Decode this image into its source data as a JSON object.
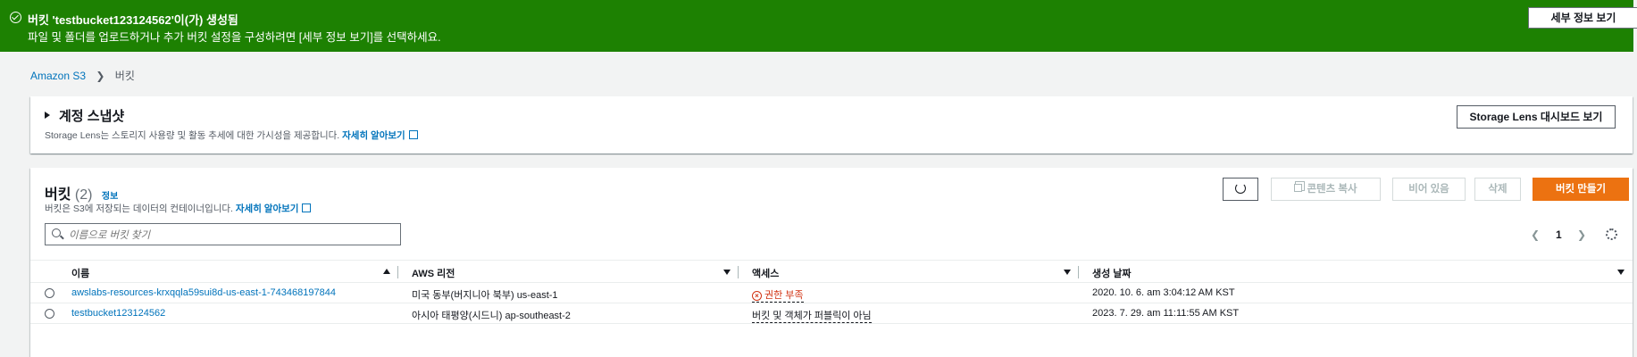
{
  "flash": {
    "title": "버킷 'testbucket123124562'이(가) 생성됨",
    "message": "파일 및 폴더를 업로드하거나 추가 버킷 설정을 구성하려면 [세부 정보 보기]를 선택하세요.",
    "details_button": "세부 정보 보기",
    "color": "#1d8102"
  },
  "breadcrumb": {
    "root": "Amazon S3",
    "current": "버킷"
  },
  "lens": {
    "heading": "계정 스냅샷",
    "description": "Storage Lens는 스토리지 사용량 및 활동 추세에 대한 가시성을 제공합니다.",
    "learn_more": "자세히 알아보기",
    "dashboard_button": "Storage Lens 대시보드 보기"
  },
  "buckets": {
    "title": "버킷",
    "count": "(2)",
    "info": "정보",
    "description": "버킷은 S3에 저장되는 데이터의 컨테이너입니다.",
    "learn_more": "자세히 알아보기",
    "toolbar": {
      "copy": "콘텐츠 복사",
      "empty": "비어 있음",
      "delete": "삭제",
      "create": "버킷 만들기",
      "create_color": "#ec7211"
    },
    "search_placeholder": "이름으로 버킷 찾기",
    "page": "1",
    "columns": {
      "name": "이름",
      "region": "AWS 리전",
      "access": "액세스",
      "created": "생성 날짜"
    },
    "rows": [
      {
        "name": "awslabs-resources-krxqqla59sui8d-us-east-1-743468197844",
        "region": "미국 동부(버지니아 북부) us-east-1",
        "access": "권한 부족",
        "created": "2020. 10. 6. am 3:04:12 AM KST"
      },
      {
        "name": "testbucket123124562",
        "region": "아시아 태평양(시드니) ap-southeast-2",
        "access": "버킷 및 객체가 퍼블릭이 아님",
        "created": "2023. 7. 29. am 11:11:55 AM KST"
      }
    ]
  }
}
